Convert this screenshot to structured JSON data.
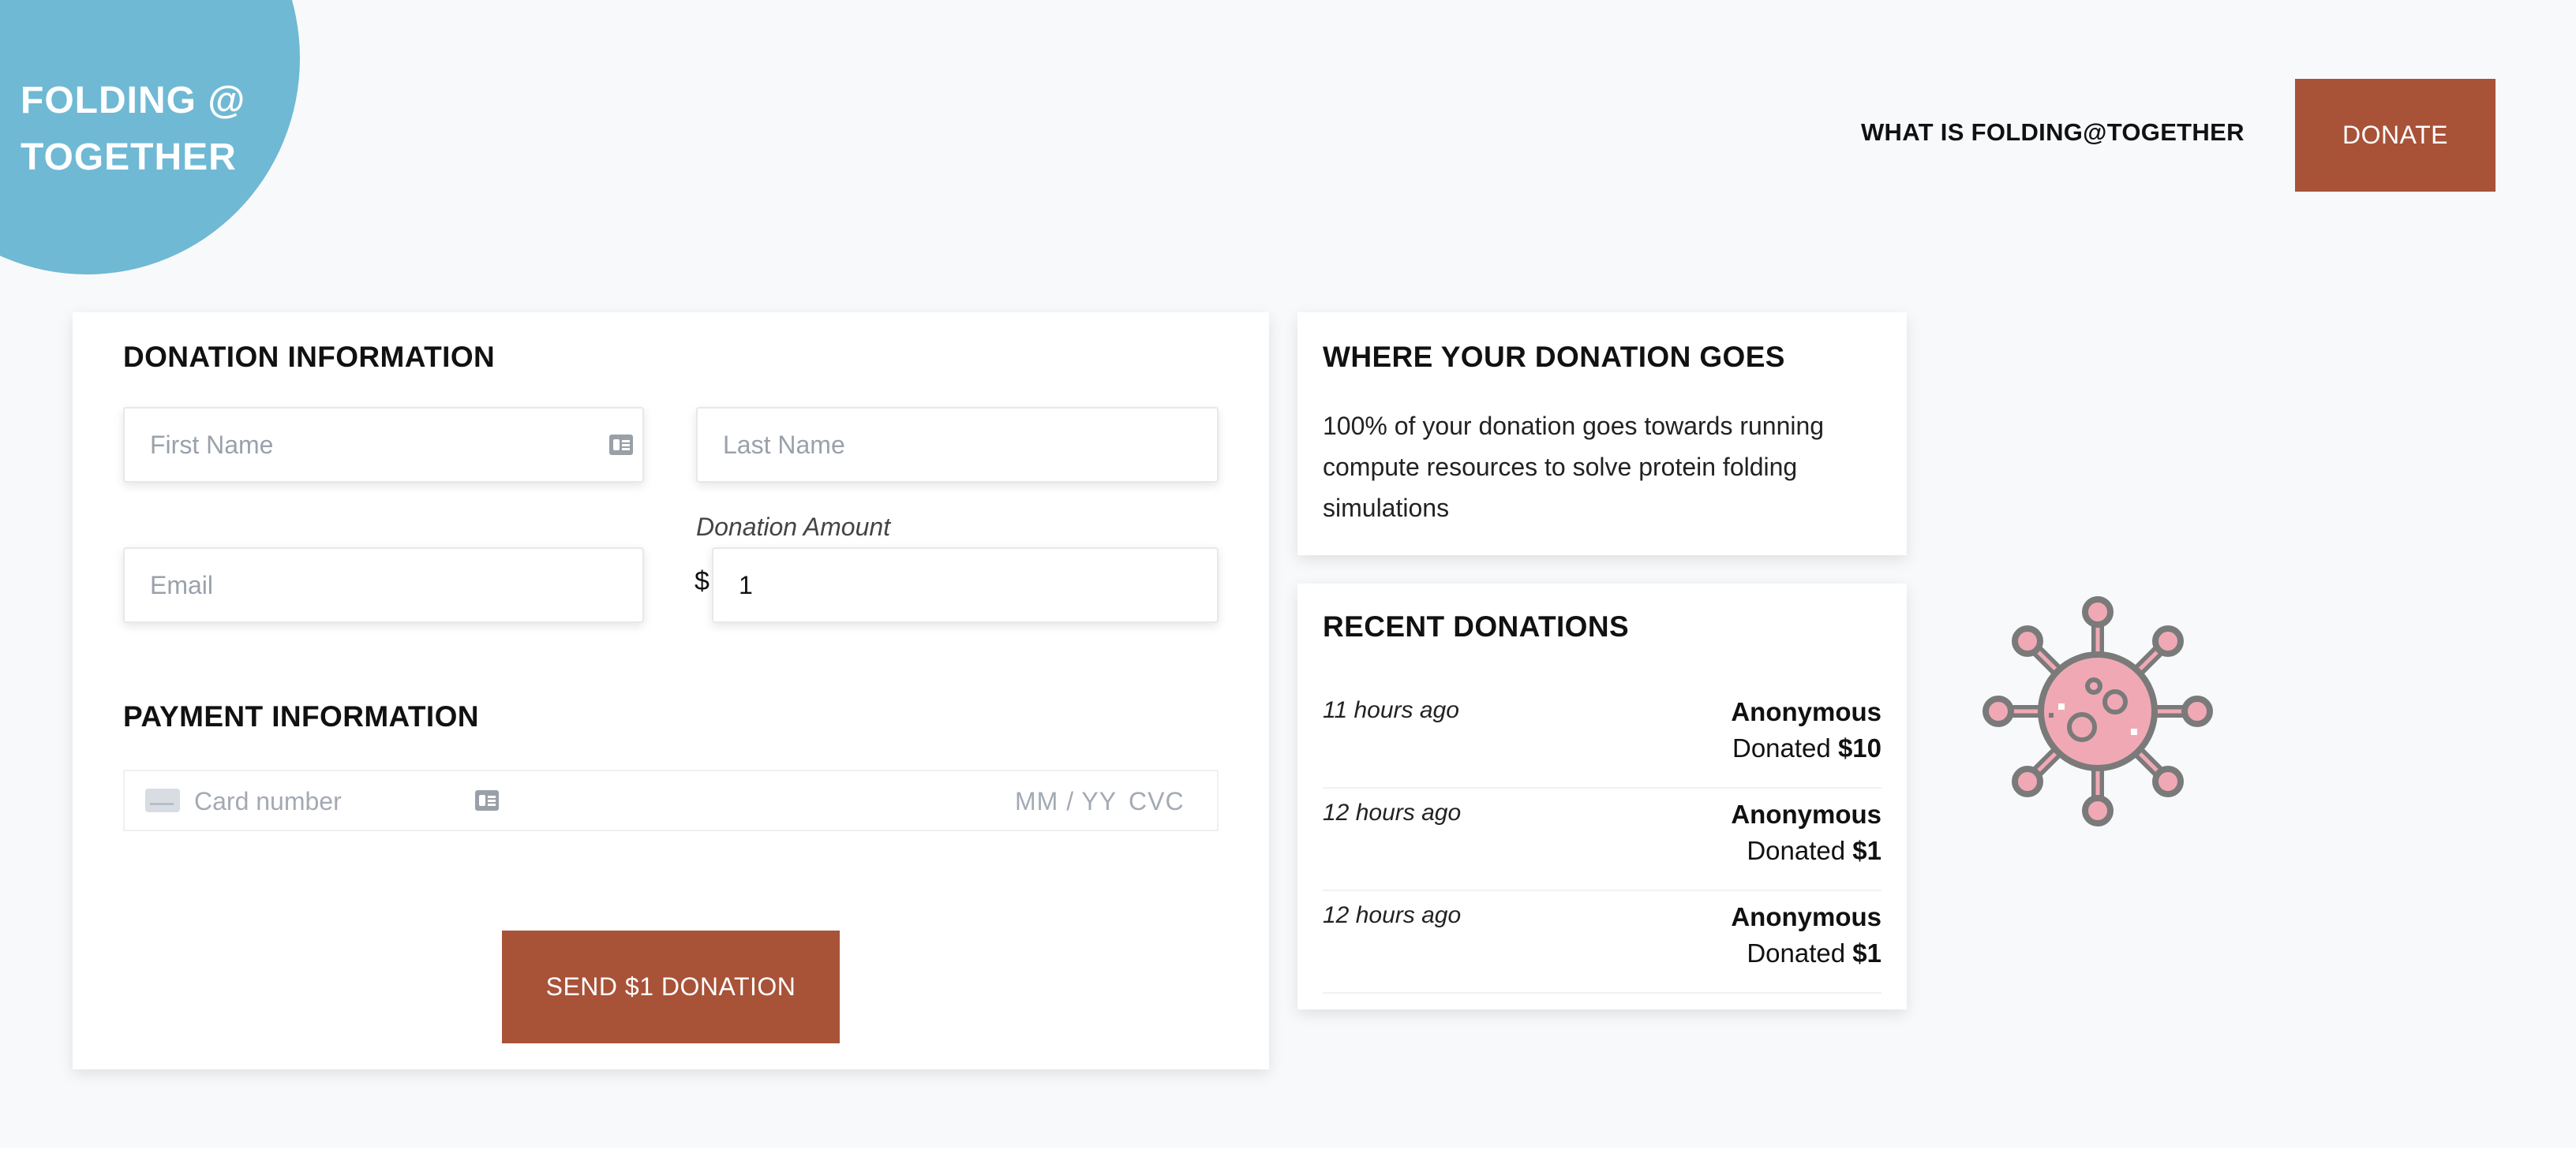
{
  "logo": {
    "text_line1": "FOLDING @",
    "text_line2": "TOGETHER"
  },
  "nav": {
    "what_is_label": "WHAT IS FOLDING@TOGETHER",
    "donate_label": "DONATE"
  },
  "donation_form": {
    "title": "DONATION INFORMATION",
    "first_name": {
      "placeholder": "First Name",
      "value": ""
    },
    "last_name": {
      "placeholder": "Last Name",
      "value": ""
    },
    "email": {
      "placeholder": "Email",
      "value": ""
    },
    "amount_label": "Donation Amount",
    "currency_symbol": "$",
    "amount_value": "1"
  },
  "payment": {
    "title": "PAYMENT INFORMATION",
    "card_number_placeholder": "Card number",
    "expiry_placeholder": "MM / YY",
    "cvc_placeholder": "CVC"
  },
  "submit": {
    "label": "SEND $1 DONATION"
  },
  "where": {
    "title": "WHERE YOUR DONATION GOES",
    "text": "100% of your donation goes towards running compute resources to solve protein folding simulations"
  },
  "recent": {
    "title": "RECENT DONATIONS",
    "donated_prefix": "Donated",
    "items": [
      {
        "time": "11 hours ago",
        "name": "Anonymous",
        "amount": "$10"
      },
      {
        "time": "12 hours ago",
        "name": "Anonymous",
        "amount": "$1"
      },
      {
        "time": "12 hours ago",
        "name": "Anonymous",
        "amount": "$1"
      }
    ]
  },
  "colors": {
    "accent": "#a85238",
    "logo_circle": "#6fb9d4",
    "virus_fill": "#f0a9b4",
    "virus_stroke": "#7a7a7a"
  },
  "icons": {
    "contact_card": "contact-card-icon",
    "credit_card": "credit-card-icon",
    "virus": "virus-icon"
  }
}
